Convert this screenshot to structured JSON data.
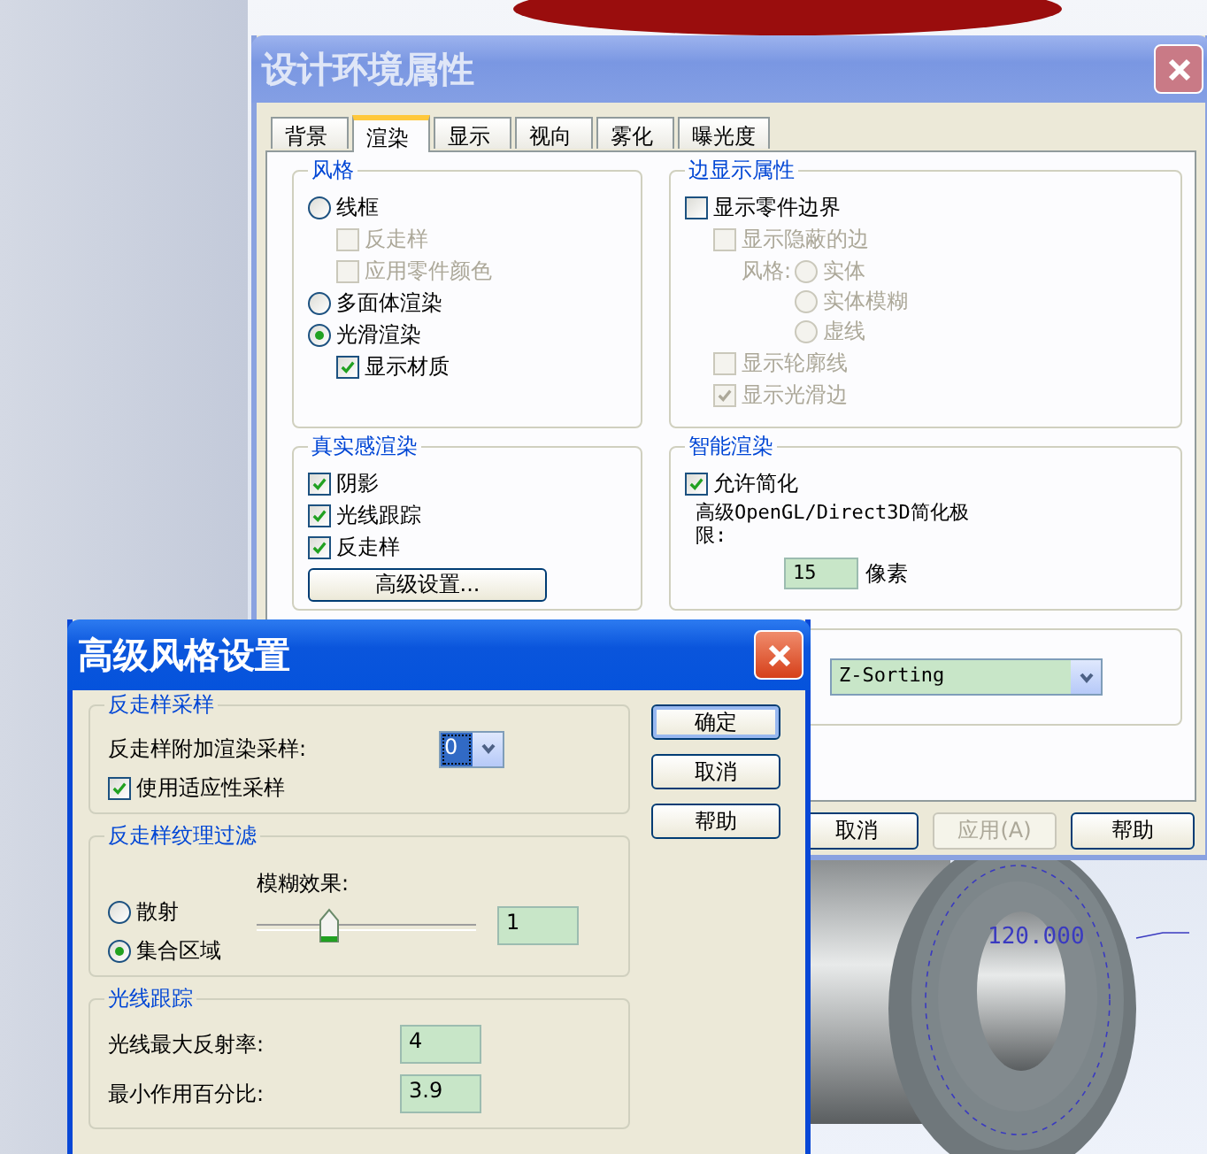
{
  "viewport": {
    "dimension": "120.000"
  },
  "main_dialog": {
    "title": "设计环境属性",
    "tabs": [
      {
        "label": "背景",
        "selected": false
      },
      {
        "label": "渲染",
        "selected": true
      },
      {
        "label": "显示",
        "selected": false
      },
      {
        "label": "视向",
        "selected": false
      },
      {
        "label": "雾化",
        "selected": false
      },
      {
        "label": "曝光度",
        "selected": false
      }
    ],
    "style_group": {
      "title": "风格",
      "items": [
        {
          "kind": "radio",
          "label": "线框",
          "selected": false,
          "disabled": false,
          "children": [
            {
              "kind": "checkbox",
              "label": "反走样",
              "checked": false,
              "disabled": true
            },
            {
              "kind": "checkbox",
              "label": "应用零件颜色",
              "checked": false,
              "disabled": true
            }
          ]
        },
        {
          "kind": "radio",
          "label": "多面体渲染",
          "selected": false,
          "disabled": false
        },
        {
          "kind": "radio",
          "label": "光滑渲染",
          "selected": true,
          "disabled": false,
          "children": [
            {
              "kind": "checkbox",
              "label": "显示材质",
              "checked": true,
              "disabled": false
            }
          ]
        }
      ]
    },
    "edge_group": {
      "title": "边显示属性",
      "items": [
        {
          "kind": "checkbox",
          "label": "显示零件边界",
          "checked": false,
          "disabled": false,
          "children": [
            {
              "kind": "checkbox",
              "label": "显示隐蔽的边",
              "checked": false,
              "disabled": true,
              "children": [
                {
                  "kind": "radio_group",
                  "label": "风格:",
                  "disabled": true,
                  "options": [
                    {
                      "label": "实体",
                      "selected": false
                    },
                    {
                      "label": "实体模糊",
                      "selected": false
                    },
                    {
                      "label": "虚线",
                      "selected": false
                    }
                  ]
                }
              ]
            },
            {
              "kind": "checkbox",
              "label": "显示轮廓线",
              "checked": false,
              "disabled": true
            },
            {
              "kind": "checkbox",
              "label": "显示光滑边",
              "checked": true,
              "disabled": true
            }
          ]
        }
      ]
    },
    "realism_group": {
      "title": "真实感渲染",
      "items": [
        {
          "kind": "checkbox",
          "label": "阴影",
          "checked": true,
          "disabled": false
        },
        {
          "kind": "checkbox",
          "label": "光线跟踪",
          "checked": true,
          "disabled": false
        },
        {
          "kind": "checkbox",
          "label": "反走样",
          "checked": true,
          "disabled": false
        }
      ],
      "button": "高级设置..."
    },
    "smart_group": {
      "title": "智能渲染",
      "checkbox": {
        "label": "允许简化",
        "checked": true
      },
      "limit_label": "高级OpenGL/Direct3D简化极限:",
      "limit_value": "15",
      "limit_unit": "像素"
    },
    "transparency_dropdown": {
      "value": "Z-Sorting"
    },
    "buttons": [
      {
        "label": "取消",
        "disabled": false
      },
      {
        "label": "应用(A)",
        "disabled": true
      },
      {
        "label": "帮助",
        "disabled": false
      }
    ]
  },
  "advanced_dialog": {
    "title": "高级风格设置",
    "sampling_group": {
      "title": "反走样采样",
      "select_label": "反走样附加渲染采样:",
      "select_value": "0",
      "checkbox": {
        "label": "使用适应性采样",
        "checked": true
      }
    },
    "filter_group": {
      "title": "反走样纹理过滤",
      "radios": [
        {
          "label": "散射",
          "selected": false
        },
        {
          "label": "集合区域",
          "selected": true
        }
      ],
      "slider_label": "模糊效果:",
      "level": 0.33,
      "slider_value": "1"
    },
    "raytrace_group": {
      "title": "光线跟踪",
      "fields": [
        {
          "label": "光线最大反射率:",
          "value": "4"
        },
        {
          "label": "最小作用百分比:",
          "value": "3.9"
        }
      ]
    },
    "buttons": [
      {
        "label": "确定",
        "default": true
      },
      {
        "label": "取消",
        "default": false
      },
      {
        "label": "帮助",
        "default": false
      }
    ]
  }
}
